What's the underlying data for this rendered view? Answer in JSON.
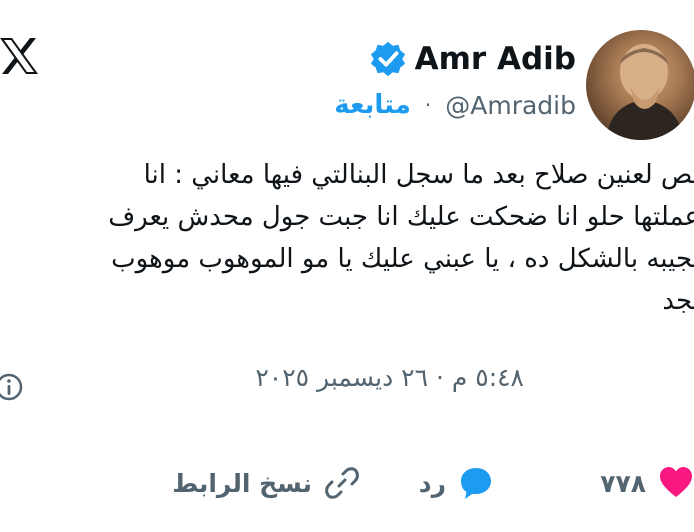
{
  "author": {
    "display_name": "Amr Adib",
    "handle": "@Amradib",
    "follow_label": "متابعة",
    "separator": "·"
  },
  "tweet": {
    "lines": [
      "بص لعنين صلاح بعد ما سجل البنالتي فيها معاني : انا",
      "عملتها حلو انا ضحكت عليك انا جبت جول محدش يعرف",
      "يجيبه بالشكل ده ، يا عبني عليك يا مو الموهوب موهوب",
      "بجد"
    ],
    "timestamp": "٥:٤٨ م · ٢٦ ديسمبر ٢٠٢٥"
  },
  "actions": {
    "likes_count": "٧٧٨",
    "reply_label": "رد",
    "copy_link_label": "نسخ الرابط"
  },
  "icons": {
    "logo": "x-logo-icon",
    "verified": "verified-badge-icon",
    "info": "info-icon",
    "like": "heart-icon",
    "reply": "speech-bubble-icon",
    "link": "link-icon"
  },
  "colors": {
    "accent": "#1d9bf0",
    "like": "#f91880",
    "secondary_text": "#536471",
    "text": "#0f1419"
  }
}
